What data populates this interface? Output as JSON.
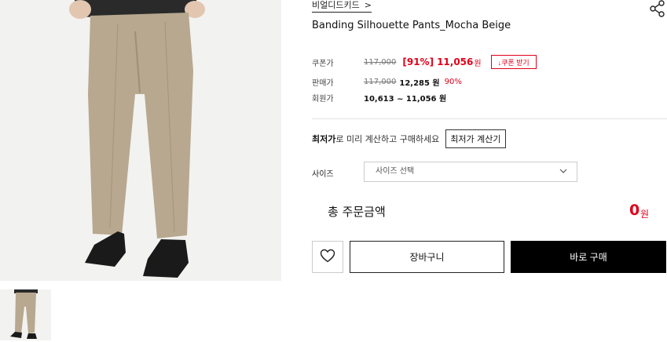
{
  "product": {
    "brand": "비얼디드키드",
    "brand_chevron": ">",
    "title": "Banding Silhouette Pants_Mocha Beige"
  },
  "pricing": {
    "coupon": {
      "label": "쿠폰가",
      "original": "117,000",
      "discount_rate": "[91%]",
      "price": "11,056",
      "unit": "원",
      "button": "↓쿠폰 받기"
    },
    "sale": {
      "label": "판매가",
      "original": "117,000",
      "price": "12,285 원",
      "rate": "90%"
    },
    "member": {
      "label": "회원가",
      "price": "10,613 ~ 11,056 원"
    }
  },
  "lowest": {
    "bold": "최저가",
    "text": "로 미리 계산하고 구매하세요",
    "button": "최저가 계산기"
  },
  "size": {
    "label": "사이즈",
    "placeholder": "사이즈 선택"
  },
  "total": {
    "label": "총 주문금액",
    "amount": "0",
    "unit": "원"
  },
  "actions": {
    "cart": "장바구니",
    "buy": "바로 구매"
  },
  "icons": {
    "share": "share-icon",
    "heart": "heart-icon",
    "chevron": "chevron-down-icon"
  },
  "colors": {
    "accent_red": "#e00019",
    "buy_button": "#000000",
    "pants": "#b7a88f"
  }
}
